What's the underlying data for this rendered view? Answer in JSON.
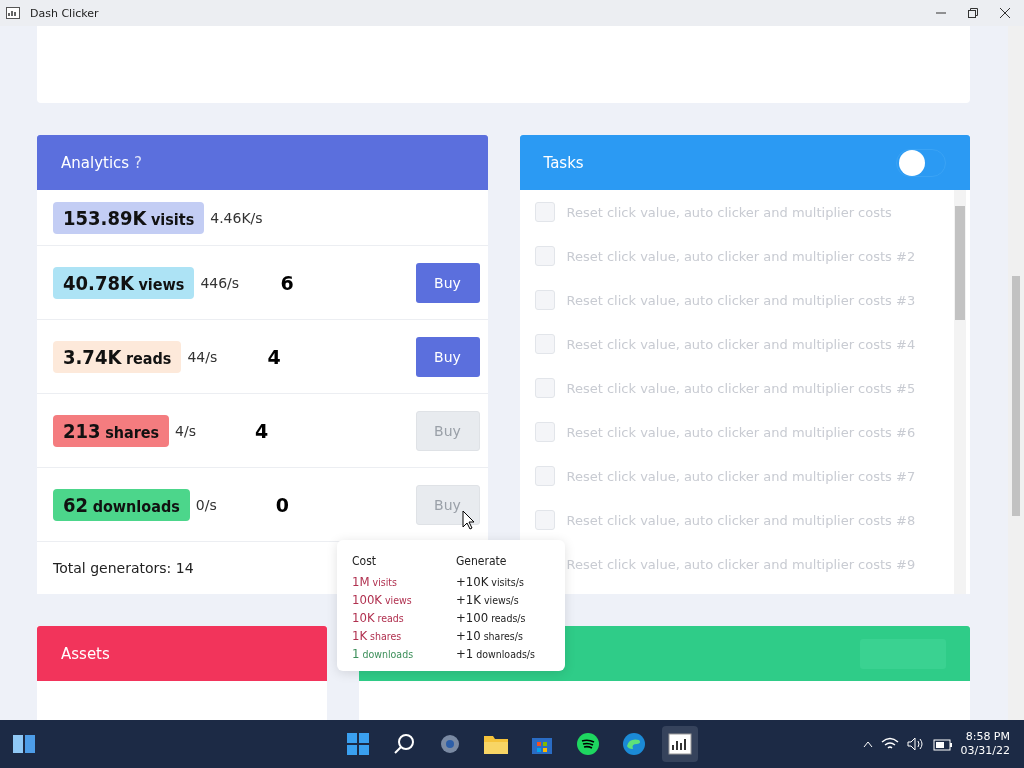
{
  "window": {
    "title": "Dash Clicker"
  },
  "analytics": {
    "title": "Analytics",
    "help": "?",
    "rows": [
      {
        "value": "153.89K",
        "unit": "visits",
        "rate": "4.46K/s",
        "color": "#c3cdf4"
      },
      {
        "value": "40.78K",
        "unit": "views",
        "rate": "446/s",
        "owned": "6",
        "buy": {
          "label": "Buy",
          "disabled": false
        },
        "color": "#ade3f5"
      },
      {
        "value": "3.74K",
        "unit": "reads",
        "rate": "44/s",
        "owned": "4",
        "buy": {
          "label": "Buy",
          "disabled": false
        },
        "color": "#fde9da"
      },
      {
        "value": "213",
        "unit": "shares",
        "rate": "4/s",
        "owned": "4",
        "buy": {
          "label": "Buy",
          "disabled": true
        },
        "color": "#f47c7f"
      },
      {
        "value": "62",
        "unit": "downloads",
        "rate": "0/s",
        "owned": "0",
        "buy": {
          "label": "Buy",
          "disabled": true
        },
        "color": "#4cd68b"
      }
    ],
    "total": "Total generators: 14"
  },
  "tasks": {
    "title": "Tasks",
    "toggle_on": false,
    "items": [
      {
        "label": "Reset click value, auto clicker and multiplier costs",
        "checked": false,
        "disabled": true
      },
      {
        "label": "Reset click value, auto clicker and multiplier costs #2",
        "checked": false,
        "disabled": true
      },
      {
        "label": "Reset click value, auto clicker and multiplier costs #3",
        "checked": false,
        "disabled": true
      },
      {
        "label": "Reset click value, auto clicker and multiplier costs #4",
        "checked": false,
        "disabled": true
      },
      {
        "label": "Reset click value, auto clicker and multiplier costs #5",
        "checked": false,
        "disabled": true
      },
      {
        "label": "Reset click value, auto clicker and multiplier costs #6",
        "checked": false,
        "disabled": true
      },
      {
        "label": "Reset click value, auto clicker and multiplier costs #7",
        "checked": false,
        "disabled": true
      },
      {
        "label": "Reset click value, auto clicker and multiplier costs #8",
        "checked": false,
        "disabled": true
      },
      {
        "label": "Reset click value, auto clicker and multiplier costs #9",
        "disabled": true
      }
    ]
  },
  "tooltip": {
    "cost_heading": "Cost",
    "generate_heading": "Generate",
    "rows": [
      {
        "cost": "1M",
        "cost_unit": "visits",
        "affordable": false,
        "gen": "+10K",
        "gen_unit": "visits/s"
      },
      {
        "cost": "100K",
        "cost_unit": "views",
        "affordable": false,
        "gen": "+1K",
        "gen_unit": "views/s"
      },
      {
        "cost": "10K",
        "cost_unit": "reads",
        "affordable": false,
        "gen": "+100",
        "gen_unit": "reads/s"
      },
      {
        "cost": "1K",
        "cost_unit": "shares",
        "affordable": false,
        "gen": "+10",
        "gen_unit": "shares/s"
      },
      {
        "cost": "1",
        "cost_unit": "downloads",
        "affordable": true,
        "gen": "+1",
        "gen_unit": "downloads/s"
      }
    ]
  },
  "assets": {
    "title": "Assets"
  },
  "taskbar": {
    "time": "8:58 PM",
    "date": "03/31/22"
  }
}
